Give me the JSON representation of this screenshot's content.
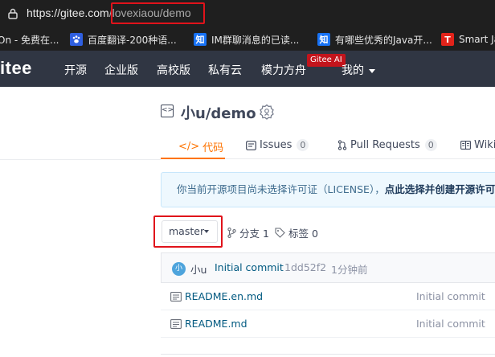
{
  "browser": {
    "url_host": "https://gitee.com",
    "url_path": "/lovexiaou/demo",
    "bookmarks": [
      {
        "label": "On - 免费在...",
        "icon": "partial-icon",
        "color": "#1f1f1f"
      },
      {
        "label": "百度翻译-200种语...",
        "icon": "baidu-paw-icon",
        "color": "#2f5fe0"
      },
      {
        "label": "IM群聊消息的已读...",
        "icon": "zhihu-icon",
        "color": "#1772f6",
        "glyph": "知"
      },
      {
        "label": "有哪些优秀的Java开...",
        "icon": "zhihu-icon",
        "color": "#1772f6",
        "glyph": "知"
      },
      {
        "label": "Smart Ja",
        "icon": "t-logo-icon",
        "color": "#e2231a",
        "glyph": "T"
      }
    ]
  },
  "nav": {
    "logo": "itee",
    "items": [
      "开源",
      "企业版",
      "高校版",
      "私有云",
      "模力方舟"
    ],
    "ai_badge": "Gitee AI",
    "mine": "我的"
  },
  "repo": {
    "title": "小u/demo",
    "tabs": [
      {
        "label": "代码",
        "icon": "code-icon",
        "active": true
      },
      {
        "label": "Issues",
        "count": "0",
        "icon": "issues-icon"
      },
      {
        "label": "Pull Requests",
        "count": "0",
        "icon": "pull-request-icon"
      },
      {
        "label": "Wiki",
        "icon": "wiki-icon"
      }
    ],
    "license_notice": "你当前开源项目尚未选择许可证（LICENSE），",
    "license_link": "点此选择并创建开源许可",
    "branch": "master",
    "branches_label": "分支 1",
    "tags_label": "标签 0",
    "commit": {
      "avatar": "小",
      "user": "小u",
      "message": "Initial commit",
      "hash": "1dd52f2",
      "time": "1分钟前"
    },
    "files": [
      {
        "name": "README.en.md",
        "commit": "Initial commit"
      },
      {
        "name": "README.md",
        "commit": "Initial commit"
      }
    ]
  },
  "colors": {
    "accent": "#fe7300",
    "nav_bg": "#303643",
    "highlight_box": "#e0131b",
    "link": "#005980"
  }
}
